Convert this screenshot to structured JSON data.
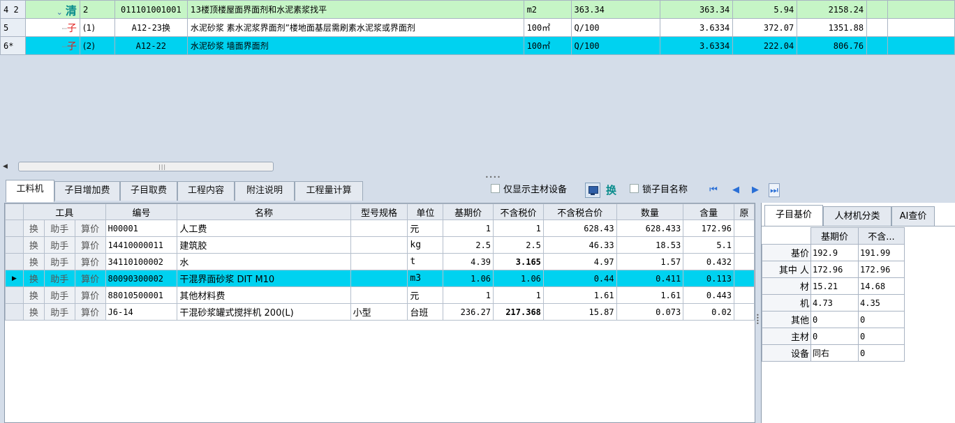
{
  "top_grid": {
    "rows": [
      {
        "rownum": "4 2",
        "tree_icon": "清",
        "level": "2",
        "code": "011101001001",
        "name": "13楼顶楼屋面界面剂和水泥素浆找平",
        "unit": "m2",
        "qty_expr": "363.34",
        "quantity": "363.34",
        "unit_price": "5.94",
        "total": "2158.24"
      },
      {
        "rownum": "5",
        "tree_icon": "子",
        "level": "(1)",
        "code": "A12-23换",
        "name": "水泥砂浆 素水泥浆界面剂”楼地面基层需刷素水泥浆或界面剂",
        "unit": "100㎡",
        "qty_expr": "Q/100",
        "quantity": "3.6334",
        "unit_price": "372.07",
        "total": "1351.88"
      },
      {
        "rownum": "6*",
        "tree_icon": "子",
        "level": "(2)",
        "code": "A12-22",
        "name": "水泥砂浆 墙面界面剂",
        "unit": "100㎡",
        "qty_expr": "Q/100",
        "quantity": "3.6334",
        "unit_price": "222.04",
        "total": "806.76"
      }
    ]
  },
  "tabs": [
    "工料机",
    "子目增加费",
    "子目取费",
    "工程内容",
    "附注说明",
    "工程量计算"
  ],
  "toolbar": {
    "main_material_only": "仅显示主材设备",
    "huan": "换",
    "lock_name": "锁子目名称"
  },
  "materials": {
    "headers": [
      "工具",
      "编号",
      "名称",
      "型号规格",
      "单位",
      "基期价",
      "不含税价",
      "不含税合价",
      "数量",
      "含量",
      "原"
    ],
    "tool_buttons": [
      "换",
      "助手",
      "算价"
    ],
    "rows": [
      {
        "code": "H00001",
        "name": "人工费",
        "spec": "",
        "unit": "元",
        "base": "1",
        "ex_tax": "1",
        "ex_tax_total": "628.43",
        "qty": "628.433",
        "content": "172.96"
      },
      {
        "code": "14410000011",
        "name": "建筑胶",
        "spec": "",
        "unit": "kg",
        "base": "2.5",
        "ex_tax": "2.5",
        "ex_tax_total": "46.33",
        "qty": "18.53",
        "content": "5.1"
      },
      {
        "code": "34110100002",
        "name": "水",
        "spec": "",
        "unit": "t",
        "base": "4.39",
        "ex_tax": "3.165",
        "ex_tax_total": "4.97",
        "qty": "1.57",
        "content": "0.432"
      },
      {
        "code": "80090300002",
        "name": "干混界面砂浆 DIT M10",
        "spec": "",
        "unit": "m3",
        "base": "1.06",
        "ex_tax": "1.06",
        "ex_tax_total": "0.44",
        "qty": "0.411",
        "content": "0.113"
      },
      {
        "code": "88010500001",
        "name": "其他材料费",
        "spec": "",
        "unit": "元",
        "base": "1",
        "ex_tax": "1",
        "ex_tax_total": "1.61",
        "qty": "1.61",
        "content": "0.443"
      },
      {
        "code": "J6-14",
        "name": "干混砂浆罐式搅拌机 200(L)",
        "spec": "小型",
        "unit": "台班",
        "base": "236.27",
        "ex_tax": "217.368",
        "ex_tax_total": "15.87",
        "qty": "0.073",
        "content": "0.02"
      }
    ]
  },
  "right_panel": {
    "tabs": [
      "子目基价",
      "人材机分类",
      "AI查价"
    ],
    "headers": [
      "基期价",
      "不含..."
    ],
    "rows": [
      {
        "label": "基价",
        "base": "192.9",
        "ex_tax": "191.99"
      },
      {
        "label": "其中 人",
        "base": "172.96",
        "ex_tax": "172.96"
      },
      {
        "label": "材",
        "base": "15.21",
        "ex_tax": "14.68"
      },
      {
        "label": "机",
        "base": "4.73",
        "ex_tax": "4.35"
      },
      {
        "label": "其他",
        "base": "0",
        "ex_tax": "0"
      },
      {
        "label": "主材",
        "base": "0",
        "ex_tax": "0"
      },
      {
        "label": "设备",
        "base": "同右",
        "ex_tax": "0"
      }
    ]
  }
}
